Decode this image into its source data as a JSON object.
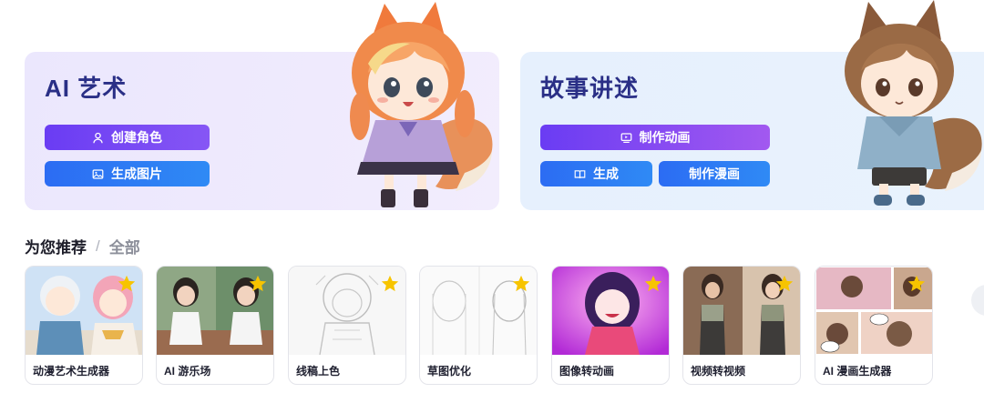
{
  "art": {
    "title": "AI 艺术",
    "create_character": "创建角色",
    "generate_image": "生成图片"
  },
  "story": {
    "title": "故事讲述",
    "make_animation": "制作动画",
    "generate": "生成",
    "make_comic": "制作漫画"
  },
  "recommend": {
    "title": "为您推荐",
    "separator": "/",
    "all": "全部"
  },
  "cards": [
    {
      "label": "动漫艺术生成器"
    },
    {
      "label": "AI 游乐场"
    },
    {
      "label": "线稿上色"
    },
    {
      "label": "草图优化"
    },
    {
      "label": "图像转动画"
    },
    {
      "label": "视频转视频"
    },
    {
      "label": "AI 漫画生成器"
    }
  ],
  "icons": {
    "person": "user-icon",
    "image": "image-icon",
    "monitor": "monitor-icon",
    "book": "book-icon",
    "star": "star-icon"
  },
  "colors": {
    "title": "#2a2f86",
    "purple": "#6a3cf3",
    "blue": "#2c6cf3",
    "star": "#f7c400"
  }
}
